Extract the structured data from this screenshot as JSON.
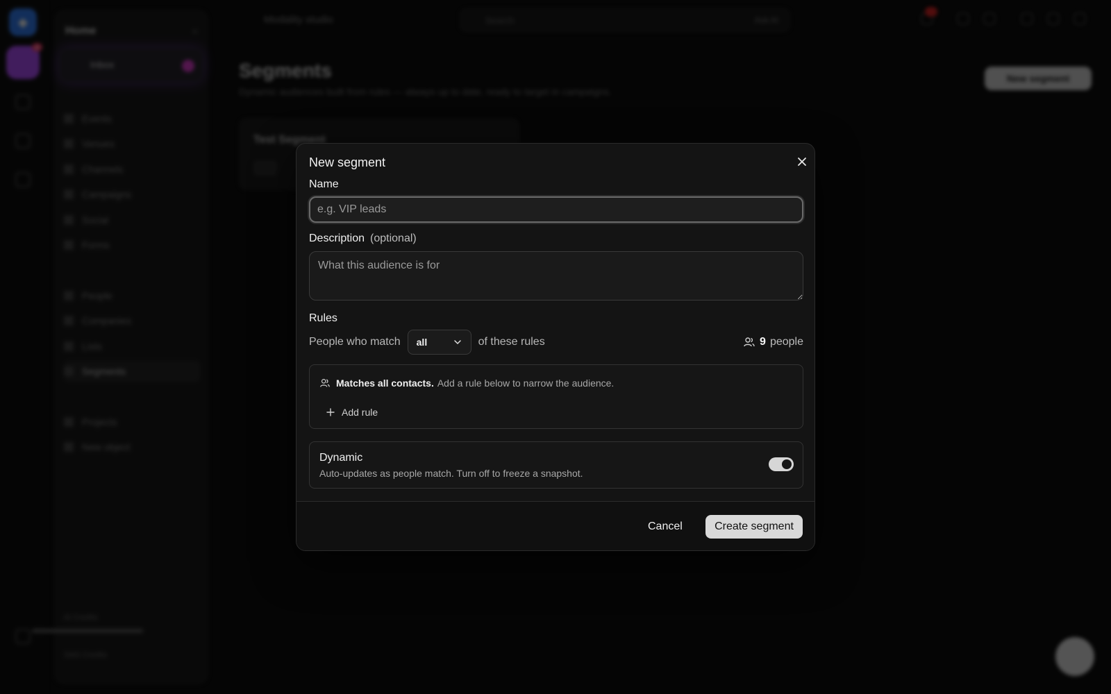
{
  "background": {
    "sidebar": {
      "title": "Home",
      "inbox_label": "Inbox",
      "items": [
        "Events",
        "Venues",
        "Channels",
        "Campaigns",
        "Social",
        "Forms",
        "People",
        "Companies",
        "Lists",
        "Segments",
        "Projects",
        "New object"
      ],
      "footer_credits": "AI Credits",
      "footer_sms": "SMS Credits"
    },
    "topbar": {
      "workspace": "Modality studio",
      "search_placeholder": "Search",
      "ask_label": "Ask AI"
    },
    "page": {
      "title": "Segments",
      "subtitle": "Dynamic audiences built from rules — always up to date, ready to target in campaigns.",
      "new_button": "New segment",
      "card_title": "Test Segment"
    }
  },
  "modal": {
    "title": "New segment",
    "name_label": "Name",
    "name_placeholder": "e.g. VIP leads",
    "description_label": "Description",
    "description_optional": "(optional)",
    "description_placeholder": "What this audience is for",
    "rules_label": "Rules",
    "match_prefix": "People who match",
    "match_value": "all",
    "match_suffix": "of these rules",
    "people_count": "9",
    "people_label": "people",
    "matches_bold": "Matches all contacts.",
    "matches_rest": "Add a rule below to narrow the audience.",
    "add_rule": "Add rule",
    "dynamic_title": "Dynamic",
    "dynamic_desc": "Auto-updates as people match. Turn off to freeze a snapshot.",
    "dynamic_enabled": true,
    "cancel": "Cancel",
    "create": "Create segment"
  }
}
